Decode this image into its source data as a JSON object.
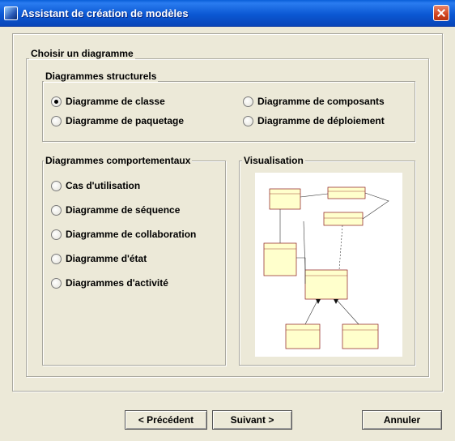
{
  "window": {
    "title": "Assistant de création de modèles"
  },
  "groups": {
    "choose": "Choisir un diagramme",
    "structural": "Diagrammes structurels",
    "behavioral": "Diagrammes comportementaux",
    "preview": "Visualisation"
  },
  "structural_options": [
    {
      "label": "Diagramme de classe",
      "checked": true
    },
    {
      "label": "Diagramme de paquetage",
      "checked": false
    },
    {
      "label": "Diagramme de composants",
      "checked": false
    },
    {
      "label": "Diagramme de déploiement",
      "checked": false
    }
  ],
  "behavioral_options": [
    {
      "label": "Cas d'utilisation",
      "checked": false
    },
    {
      "label": "Diagramme de séquence",
      "checked": false
    },
    {
      "label": "Diagramme de collaboration",
      "checked": false
    },
    {
      "label": "Diagramme d'état",
      "checked": false
    },
    {
      "label": "Diagrammes d'activité",
      "checked": false
    }
  ],
  "buttons": {
    "previous": "< Précédent",
    "next": "Suivant >",
    "cancel": "Annuler"
  },
  "colors": {
    "titlebar": "#0a5fd8",
    "uml_class_fill": "#ffffcc"
  }
}
